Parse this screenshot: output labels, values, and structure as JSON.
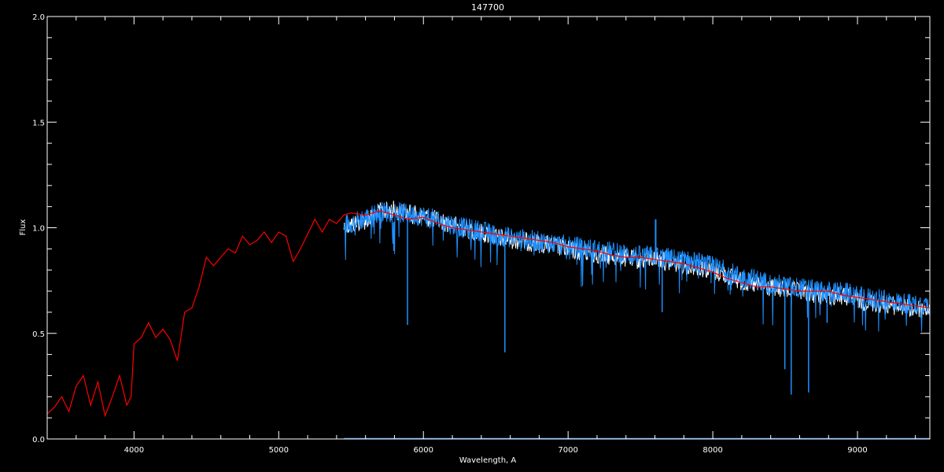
{
  "chart_data": {
    "type": "line",
    "title": "147700",
    "xlabel": "Wavelength, A",
    "ylabel": "Flux",
    "xlim": [
      3400,
      9500
    ],
    "ylim": [
      0.0,
      2.0
    ],
    "x_ticks": [
      4000,
      5000,
      6000,
      7000,
      8000,
      9000
    ],
    "x_tick_labels": [
      "4000",
      "5000",
      "6000",
      "7000",
      "8000",
      "9000"
    ],
    "y_ticks": [
      0.0,
      0.5,
      1.0,
      1.5,
      2.0
    ],
    "y_tick_labels": [
      "0.0",
      "0.5",
      "1.0",
      "1.5",
      "2.0"
    ],
    "background": "#000000",
    "axis_color": "#ffffff",
    "grid": false,
    "series": [
      {
        "color": "#ff0000",
        "x": [
          3400,
          3450,
          3500,
          3550,
          3600,
          3650,
          3700,
          3750,
          3800,
          3850,
          3900,
          3950,
          3980,
          4000,
          4050,
          4100,
          4150,
          4200,
          4250,
          4300,
          4350,
          4400,
          4450,
          4500,
          4550,
          4600,
          4650,
          4700,
          4750,
          4800,
          4850,
          4900,
          4950,
          5000,
          5050,
          5100,
          5150,
          5200,
          5250,
          5300,
          5350,
          5400,
          5450,
          5500,
          5600,
          5700,
          5800,
          5900,
          6000,
          6100,
          6200,
          6300,
          6400,
          6500,
          6600,
          6700,
          6800,
          6900,
          7000,
          7100,
          7200,
          7300,
          7400,
          7500,
          7600,
          7700,
          7800,
          7900,
          8000,
          8100,
          8200,
          8300,
          8400,
          8500,
          8600,
          8700,
          8800,
          8900,
          9000,
          9100,
          9200,
          9300,
          9400,
          9500
        ],
        "y": [
          0.12,
          0.15,
          0.2,
          0.13,
          0.25,
          0.3,
          0.16,
          0.27,
          0.11,
          0.2,
          0.3,
          0.16,
          0.2,
          0.45,
          0.48,
          0.55,
          0.48,
          0.52,
          0.47,
          0.37,
          0.6,
          0.62,
          0.72,
          0.86,
          0.82,
          0.86,
          0.9,
          0.88,
          0.96,
          0.92,
          0.94,
          0.98,
          0.93,
          0.98,
          0.96,
          0.84,
          0.9,
          0.97,
          1.04,
          0.98,
          1.04,
          1.02,
          1.06,
          1.07,
          1.06,
          1.08,
          1.06,
          1.04,
          1.05,
          1.02,
          1.0,
          0.99,
          0.98,
          0.97,
          0.96,
          0.95,
          0.94,
          0.93,
          0.91,
          0.9,
          0.89,
          0.87,
          0.86,
          0.86,
          0.85,
          0.84,
          0.83,
          0.81,
          0.79,
          0.76,
          0.74,
          0.72,
          0.72,
          0.71,
          0.7,
          0.7,
          0.7,
          0.68,
          0.67,
          0.66,
          0.65,
          0.64,
          0.63,
          0.62
        ]
      },
      {
        "color": "#ffffff",
        "x": [
          5450,
          5600,
          5700,
          5800,
          5900,
          6000,
          6100,
          6200,
          6300,
          6400,
          6500,
          6600,
          6700,
          6800,
          6900,
          7000,
          7100,
          7200,
          7300,
          7400,
          7500,
          7600,
          7700,
          7800,
          7900,
          8000,
          8100,
          8200,
          8300,
          8400,
          8500,
          8600,
          8700,
          8800,
          8900,
          9000,
          9100,
          9200,
          9300,
          9400,
          9500
        ],
        "y": [
          1.05,
          1.08,
          1.12,
          1.13,
          1.11,
          1.1,
          1.08,
          1.06,
          1.04,
          1.02,
          1.0,
          0.99,
          0.98,
          0.97,
          0.96,
          0.94,
          0.93,
          0.92,
          0.91,
          0.9,
          0.89,
          0.9,
          0.88,
          0.87,
          0.86,
          0.84,
          0.82,
          0.79,
          0.77,
          0.76,
          0.75,
          0.74,
          0.73,
          0.72,
          0.72,
          0.7,
          0.69,
          0.68,
          0.67,
          0.66,
          0.66
        ]
      },
      {
        "color": "#1e90ff",
        "x": [
          5450,
          5600,
          5700,
          5800,
          5900,
          6000,
          6100,
          6200,
          6300,
          6400,
          6500,
          6600,
          6700,
          6800,
          6900,
          7000,
          7100,
          7200,
          7300,
          7400,
          7500,
          7600,
          7700,
          7800,
          7900,
          8000,
          8100,
          8200,
          8300,
          8400,
          8500,
          8600,
          8700,
          8800,
          8900,
          9000,
          9100,
          9200,
          9300,
          9400,
          9500
        ],
        "y": [
          1.02,
          1.05,
          1.08,
          1.08,
          1.07,
          1.06,
          1.04,
          1.02,
          1.0,
          0.99,
          0.97,
          0.96,
          0.95,
          0.94,
          0.93,
          0.92,
          0.91,
          0.9,
          0.89,
          0.88,
          0.87,
          0.87,
          0.86,
          0.85,
          0.84,
          0.82,
          0.8,
          0.77,
          0.76,
          0.74,
          0.73,
          0.72,
          0.71,
          0.7,
          0.7,
          0.68,
          0.67,
          0.66,
          0.65,
          0.64,
          0.64
        ],
        "absorption_lines": [
          {
            "x": 5890,
            "y": 0.54
          },
          {
            "x": 6563,
            "y": 0.41
          },
          {
            "x": 7650,
            "y": 0.6
          },
          {
            "x": 8498,
            "y": 0.33
          },
          {
            "x": 8542,
            "y": 0.21
          },
          {
            "x": 8662,
            "y": 0.22
          },
          {
            "x": 8790,
            "y": 0.55
          }
        ],
        "emission_lines": [
          {
            "x": 7605,
            "y": 1.04
          }
        ]
      }
    ]
  }
}
